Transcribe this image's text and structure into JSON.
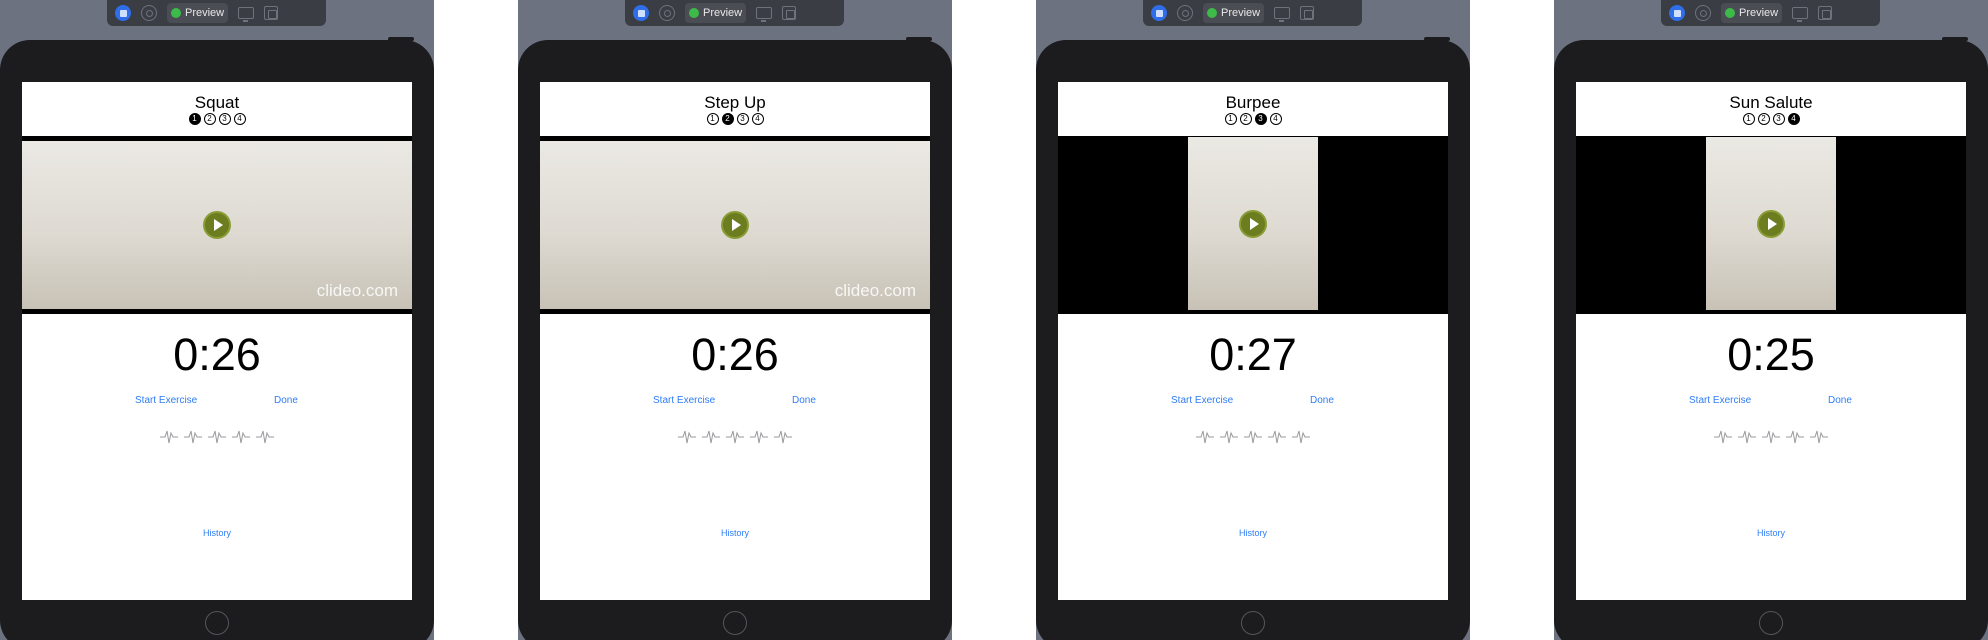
{
  "toolbar": {
    "preview_label": "Preview"
  },
  "panels": [
    {
      "title": "Squat",
      "active_page": 1,
      "timer": "0:26",
      "start_label": "Start Exercise",
      "done_label": "Done",
      "history_label": "History",
      "watermark": "clideo.com"
    },
    {
      "title": "Step Up",
      "active_page": 2,
      "timer": "0:26",
      "start_label": "Start Exercise",
      "done_label": "Done",
      "history_label": "History",
      "watermark": "clideo.com"
    },
    {
      "title": "Burpee",
      "active_page": 3,
      "timer": "0:27",
      "start_label": "Start Exercise",
      "done_label": "Done",
      "history_label": "History",
      "watermark": ""
    },
    {
      "title": "Sun Salute",
      "active_page": 4,
      "timer": "0:25",
      "start_label": "Start Exercise",
      "done_label": "Done",
      "history_label": "History",
      "watermark": ""
    }
  ],
  "page_numbers": [
    "1",
    "2",
    "3",
    "4"
  ],
  "rating_icon": "waveform-icon",
  "rating_count": 5
}
